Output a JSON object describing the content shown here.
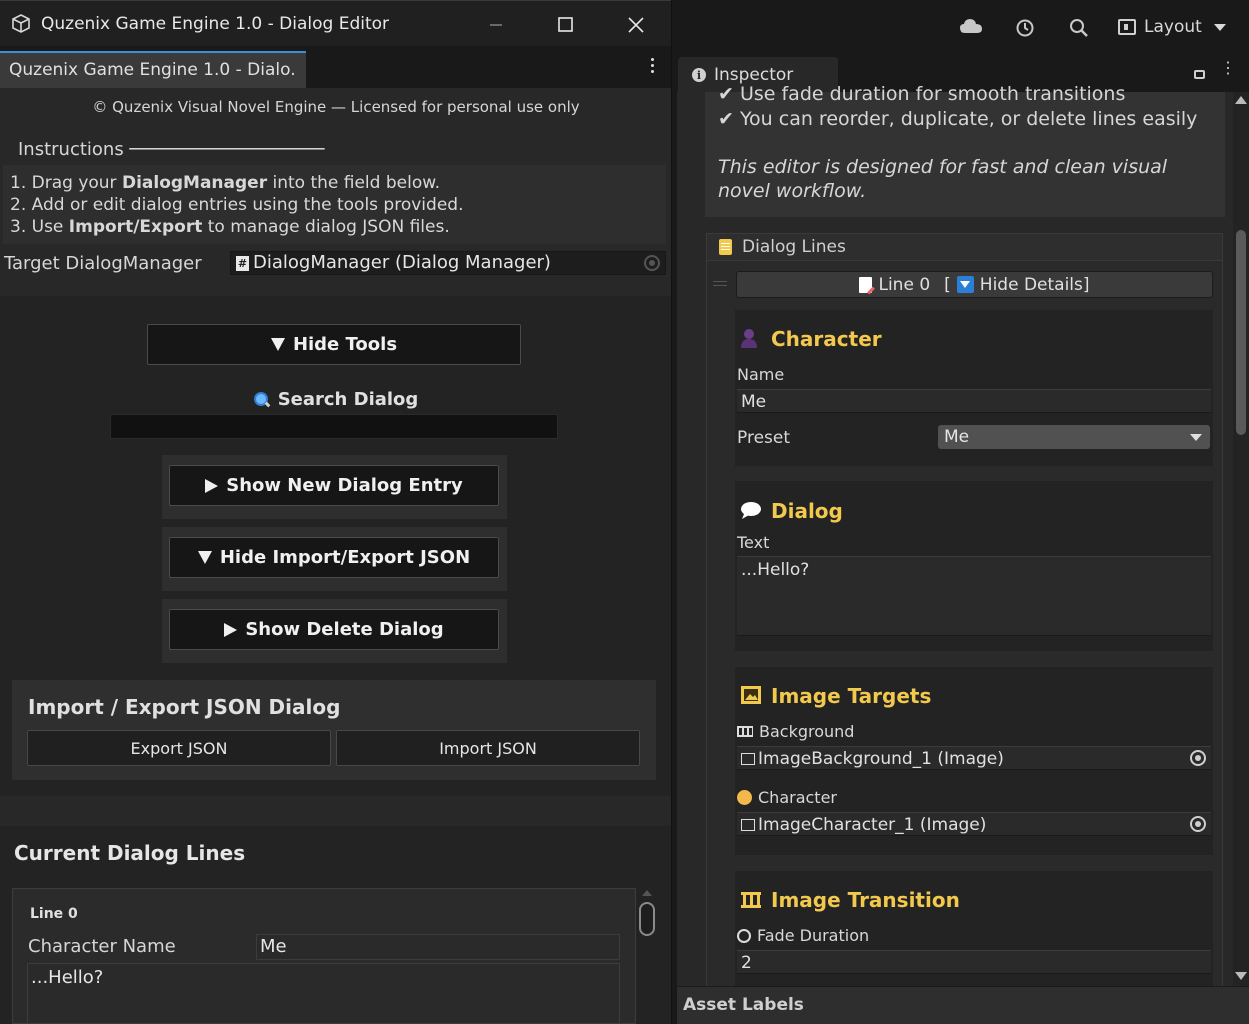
{
  "window": {
    "title": "Quzenix Game Engine 1.0 - Dialog Editor",
    "tab": "Quzenix Game Engine 1.0 - Dialo.",
    "license": "© Quzenix Visual Novel Engine — Licensed for personal use only"
  },
  "instructions": {
    "header": "Instructions ──────────────────",
    "line1": {
      "pre": "1. Drag your ",
      "bold": "DialogManager",
      "post": " into the field below."
    },
    "line2": "2. Add or edit dialog entries using the tools provided.",
    "line3": {
      "pre": "3. Use ",
      "bold": "Import/Export",
      "post": " to manage dialog JSON files."
    }
  },
  "target": {
    "label": "Target DialogManager",
    "value": "DialogManager (Dialog Manager)"
  },
  "tools": {
    "hide_tools": "Hide Tools",
    "search_label": "Search Dialog",
    "search_value": "",
    "show_new": "Show New Dialog Entry",
    "hide_import": "Hide Import/Export JSON",
    "show_delete": "Show Delete Dialog"
  },
  "import_export": {
    "title": "Import / Export JSON Dialog",
    "export": "Export JSON",
    "import": "Import JSON"
  },
  "current": {
    "title": "Current Dialog Lines",
    "line_label": "Line 0",
    "name_label": "Character Name",
    "name_value": "Me",
    "text_value": "...Hello?"
  },
  "topbar": {
    "layout": "Layout"
  },
  "inspector": {
    "tab": "Inspector",
    "help_line1": "✔ Use fade duration for smooth transitions",
    "help_line2": "✔ You can reorder, duplicate, or delete lines easily",
    "help_italic1": "This editor is designed for fast and clean visual",
    "help_italic2": "novel workflow.",
    "dialog_lines": "Dialog Lines",
    "line_btn": {
      "line": "Line 0",
      "open": "[",
      "action": "Hide Details]"
    },
    "character": {
      "title": "Character",
      "name_label": "Name",
      "name_value": "Me",
      "preset_label": "Preset",
      "preset_value": "Me"
    },
    "dialog": {
      "title": "Dialog",
      "text_label": "Text",
      "text_value": "...Hello?"
    },
    "image_targets": {
      "title": "Image Targets",
      "bg_label": "Background",
      "bg_value": "ImageBackground_1 (Image)",
      "char_label": "Character",
      "char_value": "ImageCharacter_1 (Image)"
    },
    "transition": {
      "title": "Image Transition",
      "fade_label": "Fade Duration",
      "fade_value": "2"
    }
  },
  "asset_labels": "Asset Labels",
  "colors": {
    "accent": "#f2c94c",
    "tab_highlight": "#3d8fd9",
    "background": "#282828"
  }
}
